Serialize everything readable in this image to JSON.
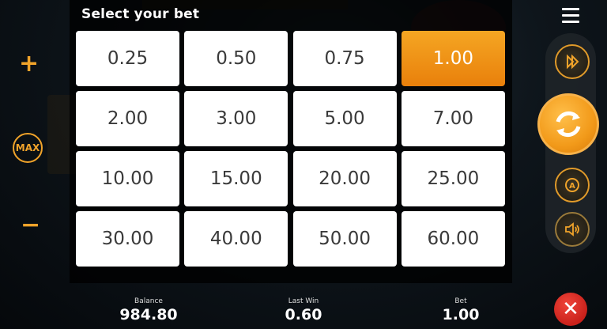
{
  "title": "Select your bet",
  "bets": [
    "0.25",
    "0.50",
    "0.75",
    "1.00",
    "2.00",
    "3.00",
    "5.00",
    "7.00",
    "10.00",
    "15.00",
    "20.00",
    "25.00",
    "30.00",
    "40.00",
    "50.00",
    "60.00"
  ],
  "selected_bet": "1.00",
  "controls": {
    "plus": "+",
    "max": "MAX",
    "minus": "−"
  },
  "icons": {
    "menu": "menu-icon",
    "turbo": "fast-forward-icon",
    "spin": "spin-icon",
    "autoplay": "autoplay-icon",
    "sound": "sound-icon",
    "close": "close-icon"
  },
  "footer": {
    "balance_label": "Balance",
    "balance": "984.80",
    "last_win_label": "Last Win",
    "last_win": "0.60",
    "bet_label": "Bet",
    "bet": "1.00"
  },
  "colors": {
    "accent": "#f0a32a",
    "selected": "#f29a1a",
    "close": "#d6261f"
  }
}
